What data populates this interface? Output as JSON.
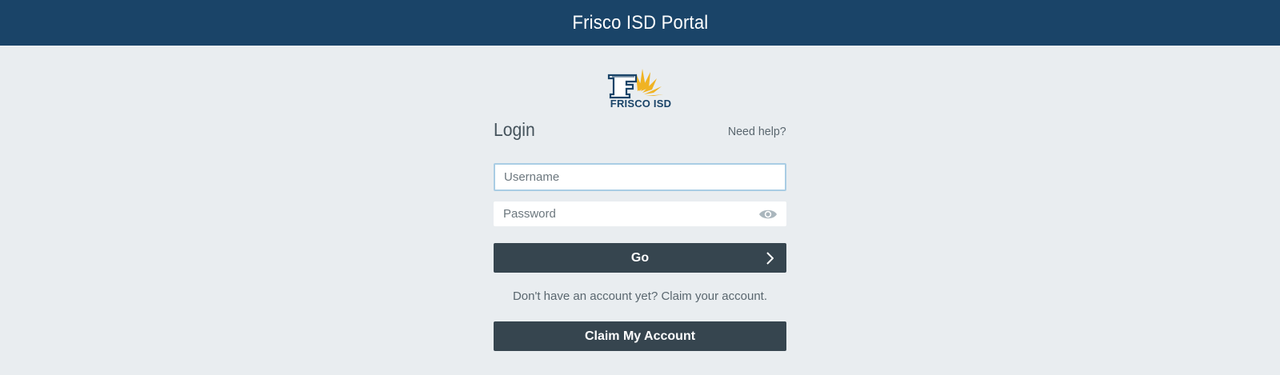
{
  "header": {
    "title": "Frisco ISD Portal"
  },
  "logo": {
    "text": "FRISCO ISD"
  },
  "login": {
    "heading": "Login",
    "help_link": "Need help?",
    "username_placeholder": "Username",
    "password_placeholder": "Password",
    "go_label": "Go",
    "claim_prompt": "Don't have an account yet? Claim your account.",
    "claim_button_label": "Claim My Account"
  },
  "colors": {
    "header_bg": "#1a4468",
    "page_bg": "#e9edf0",
    "button_bg": "#36454f",
    "logo_gold": "#f0b323",
    "focus_border": "#a9cde4"
  },
  "icons": {
    "password_toggle": "eye-icon",
    "go_arrow": "chevron-right-icon"
  }
}
